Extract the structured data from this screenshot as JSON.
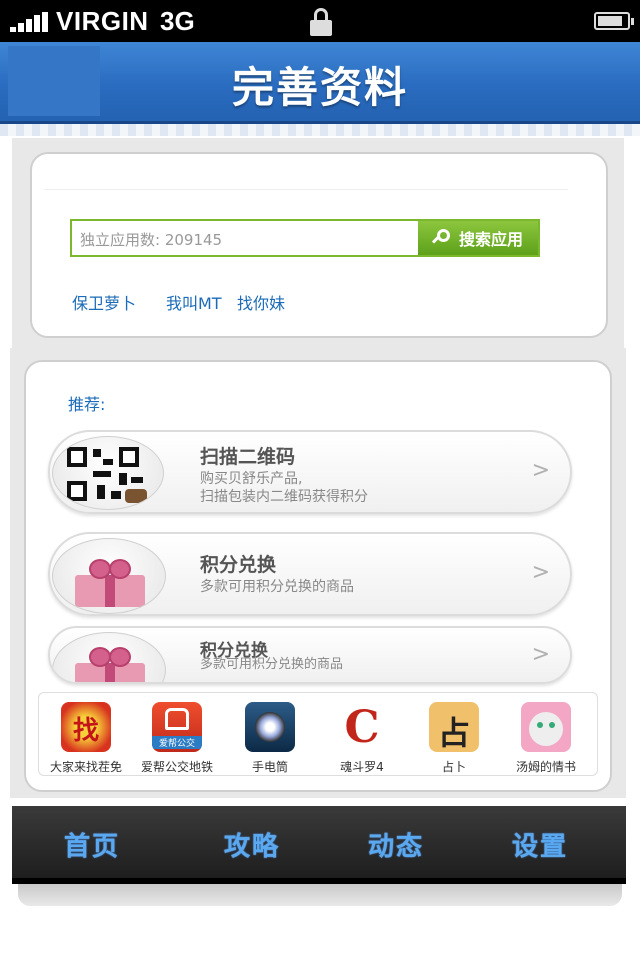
{
  "status_bar": {
    "carrier": "VIRGIN",
    "network": "3G",
    "battery_level": 0.85
  },
  "header": {
    "title": "完善资料"
  },
  "search": {
    "placeholder": "独立应用数: 209145",
    "button_label": "搜索应用"
  },
  "hot_keywords": [
    "保卫萝卜",
    "我叫MT",
    "找你妹"
  ],
  "recommend": {
    "label": "推荐:",
    "items": [
      {
        "title": "扫描二维码",
        "desc_line1": "购买贝舒乐产品,",
        "desc_line2": "扫描包装内二维码获得积分",
        "arrow": ">"
      },
      {
        "title": "积分兑换",
        "desc_line1": "多款可用积分兑换的商品",
        "arrow": ">"
      },
      {
        "title": "积分兑换",
        "desc_line1": "多款可用积分兑换的商品",
        "arrow": ">"
      }
    ]
  },
  "apps": [
    {
      "name": "大家来找茬免",
      "icon": "find-difference-app-icon",
      "glyph": "找"
    },
    {
      "name": "爱帮公交地铁",
      "icon": "bus-app-icon",
      "glyph": "爱帮公交"
    },
    {
      "name": "手电筒",
      "icon": "flashlight-app-icon"
    },
    {
      "name": "魂斗罗4",
      "icon": "contra-app-icon",
      "glyph": "C"
    },
    {
      "name": "占卜",
      "icon": "divination-app-icon",
      "glyph": "占"
    },
    {
      "name": "汤姆的情书",
      "icon": "talking-cat-app-icon"
    }
  ],
  "tabs": [
    "首页",
    "攻略",
    "动态",
    "设置"
  ],
  "colors": {
    "header_blue": "#2a6cc0",
    "search_green": "#6aab22",
    "link_blue": "#1b6bb8",
    "tab_text": "#5aa9f0"
  }
}
